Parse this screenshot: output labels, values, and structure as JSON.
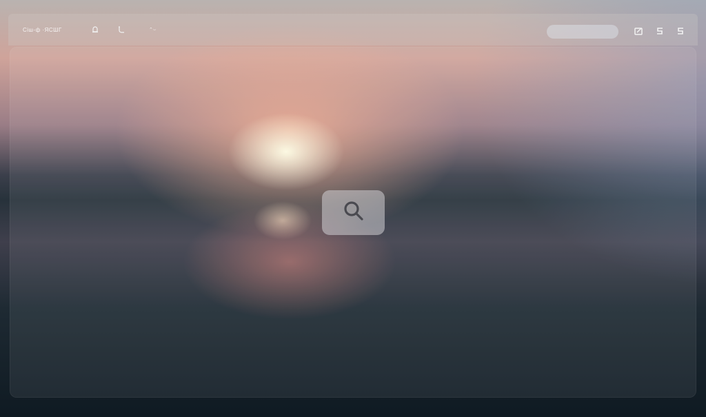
{
  "header": {
    "brand": "Ciш-ф ·ЯСШГ",
    "nav_text": "⌃⌣",
    "nav_icons": [
      "bell-icon",
      "phone-icon"
    ]
  },
  "search": {
    "value": "",
    "placeholder": ""
  },
  "toolbar": {
    "icons": [
      "edit-icon",
      "s-icon",
      "s-icon"
    ]
  },
  "main": {
    "center_icon": "search-icon"
  },
  "colors": {
    "header_bg": "#cfc9c4",
    "icon_color": "#f2f2f2",
    "search_tile_bg": "#d2d0d4",
    "search_glyph": "#4a4a50"
  }
}
